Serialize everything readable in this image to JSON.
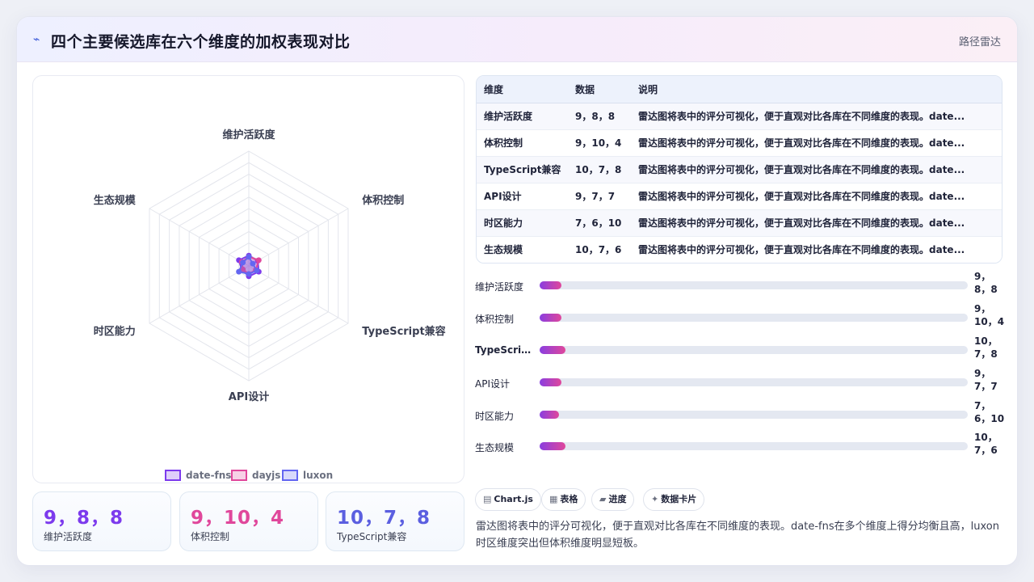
{
  "header": {
    "icon": "sparkline-icon",
    "title": "四个主要候选库在六个维度的加权表现对比",
    "tag": "路径雷达"
  },
  "chart_data": {
    "type": "radar",
    "axes": [
      "维护活跃度",
      "体积控制",
      "TypeScript兼容",
      "API设计",
      "时区能力",
      "生态规模"
    ],
    "rmax": 100,
    "series": [
      {
        "name": "date-fns",
        "values": [
          9,
          9,
          10,
          9,
          7,
          10
        ],
        "color": "#7c3aed"
      },
      {
        "name": "dayjs",
        "values": [
          8,
          10,
          7,
          7,
          6,
          7
        ],
        "color": "#e0479b"
      },
      {
        "name": "luxon",
        "values": [
          8,
          4,
          8,
          7,
          10,
          6
        ],
        "color": "#6366f1"
      }
    ],
    "legend": "bottom"
  },
  "stats": [
    {
      "value": "9，8，8",
      "label": "维护活跃度",
      "color": "#7c3aed"
    },
    {
      "value": "9，10，4",
      "label": "体积控制",
      "color": "#e0479b"
    },
    {
      "value": "10，7，8",
      "label": "TypeScript兼容",
      "color": "#5b5fe0"
    }
  ],
  "table": {
    "headers": [
      "维度",
      "数据",
      "说明"
    ],
    "rows": [
      [
        "维护活跃度",
        "9，8，8",
        "雷达图将表中的评分可视化，便于直观对比各库在不同维度的表现。date..."
      ],
      [
        "体积控制",
        "9，10，4",
        "雷达图将表中的评分可视化，便于直观对比各库在不同维度的表现。date..."
      ],
      [
        "TypeScript兼容",
        "10，7，8",
        "雷达图将表中的评分可视化，便于直观对比各库在不同维度的表现。date..."
      ],
      [
        "API设计",
        "9，7，7",
        "雷达图将表中的评分可视化，便于直观对比各库在不同维度的表现。date..."
      ],
      [
        "时区能力",
        "7，6，10",
        "雷达图将表中的评分可视化，便于直观对比各库在不同维度的表现。date..."
      ],
      [
        "生态规模",
        "10，7，6",
        "雷达图将表中的评分可视化，便于直观对比各库在不同维度的表现。date..."
      ]
    ]
  },
  "bars": [
    {
      "label": "维护活跃度",
      "value_line1": "9，",
      "value_line2": "8，8",
      "fraction": 0.05
    },
    {
      "label": "体积控制",
      "value_line1": "9，",
      "value_line2": "10，4",
      "fraction": 0.05
    },
    {
      "label": "TypeScri...",
      "value_line1": "10，",
      "value_line2": "7，8",
      "fraction": 0.06
    },
    {
      "label": "API设计",
      "value_line1": "9，",
      "value_line2": "7，7",
      "fraction": 0.05
    },
    {
      "label": "时区能力",
      "value_line1": "7，",
      "value_line2": "6，10",
      "fraction": 0.045
    },
    {
      "label": "生态规模",
      "value_line1": "10，",
      "value_line2": "7，6",
      "fraction": 0.06
    }
  ],
  "chips": [
    {
      "icon": "chart-icon",
      "glyph": "▤",
      "label": "Chart.js"
    },
    {
      "icon": "table-icon",
      "glyph": "▦",
      "label": "表格"
    },
    {
      "icon": "progress-icon",
      "glyph": "▰",
      "label": "进度"
    },
    {
      "icon": "card-icon",
      "glyph": "✦",
      "label": "数据卡片"
    }
  ],
  "description": "雷达图将表中的评分可视化，便于直观对比各库在不同维度的表现。date-fns在多个维度上得分均衡且高，luxon时区维度突出但体积维度明显短板。"
}
